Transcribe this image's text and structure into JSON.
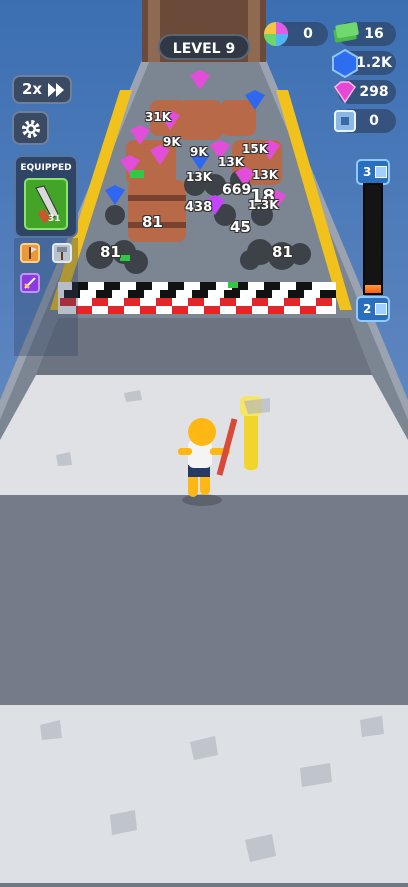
{
  "hud": {
    "level": "LEVEL 9",
    "speed": "2x",
    "balls": "0",
    "cash": "16",
    "blue_gems": "1.2K",
    "pink_gems": "298",
    "chips": "0"
  },
  "equipped": {
    "title": "EQUIPPED",
    "level": "31"
  },
  "progress": {
    "current_stage": "3",
    "next_stage": "2",
    "fill_fraction": 0.07
  },
  "track": {
    "labels": [
      "81",
      "81",
      "81",
      "81",
      "438",
      "45",
      "669",
      "18",
      "13K",
      "13K",
      "13K",
      "9K",
      "9K",
      "15K",
      "1.3K",
      "31K"
    ]
  },
  "colors": {
    "hud_bg": "#2f3844",
    "equipped_green": "#43a528",
    "road": "#6f7885",
    "checker_red": "#e2262a"
  }
}
